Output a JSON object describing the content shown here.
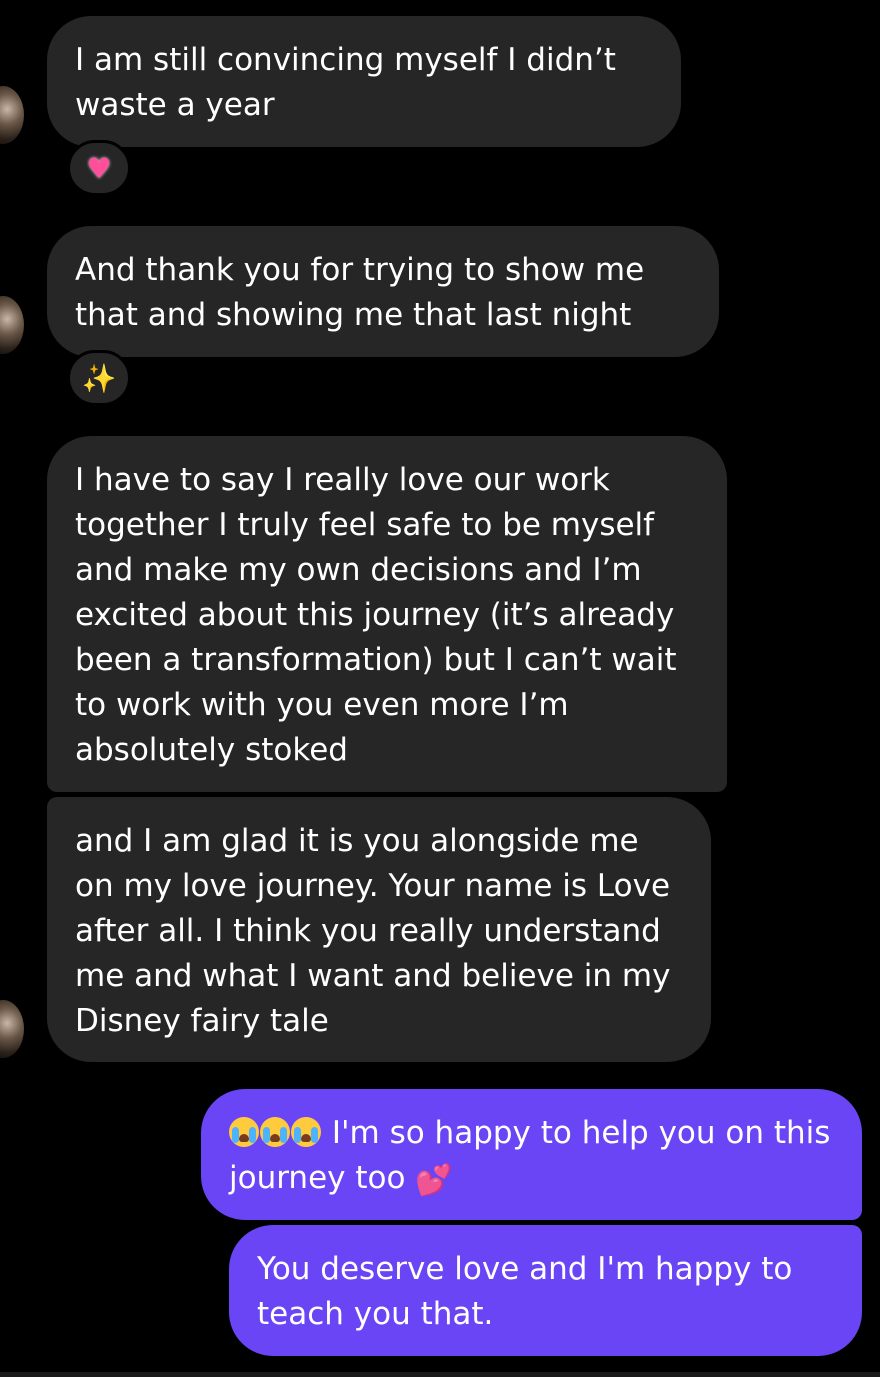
{
  "messages": [
    {
      "text": "I am still convincing myself I didn’t waste a year",
      "reaction": "♥"
    },
    {
      "text": "And thank you for trying to show me that and showing me that last night",
      "reaction": "✨"
    },
    {
      "text": "I have to say I really love our work together I truly feel safe to be myself and make my own decisions and I’m excited about this journey (it’s already been a transformation) but I can’t wait to work with you even more I’m absolutely stoked"
    },
    {
      "text": "and I am glad it is you alongside me on my love journey. Your name is Love after all. I think you really understand me and what I want and believe in my Disney fairy tale"
    }
  ],
  "replies": [
    {
      "text": "I'm so happy to help you on this journey too",
      "suffix_emoji": "💕"
    },
    {
      "text": "You deserve love and I'm happy to teach you that."
    }
  ],
  "colors": {
    "background": "#000000",
    "incoming_bubble": "#262626",
    "outgoing_bubble": "#6a45f5"
  },
  "icons": {
    "reaction_1": "sparkling-heart-icon",
    "reaction_2": "sparkles-icon",
    "reply_prefix": "loudly-crying-face-icon",
    "reply_suffix": "two-hearts-icon"
  }
}
